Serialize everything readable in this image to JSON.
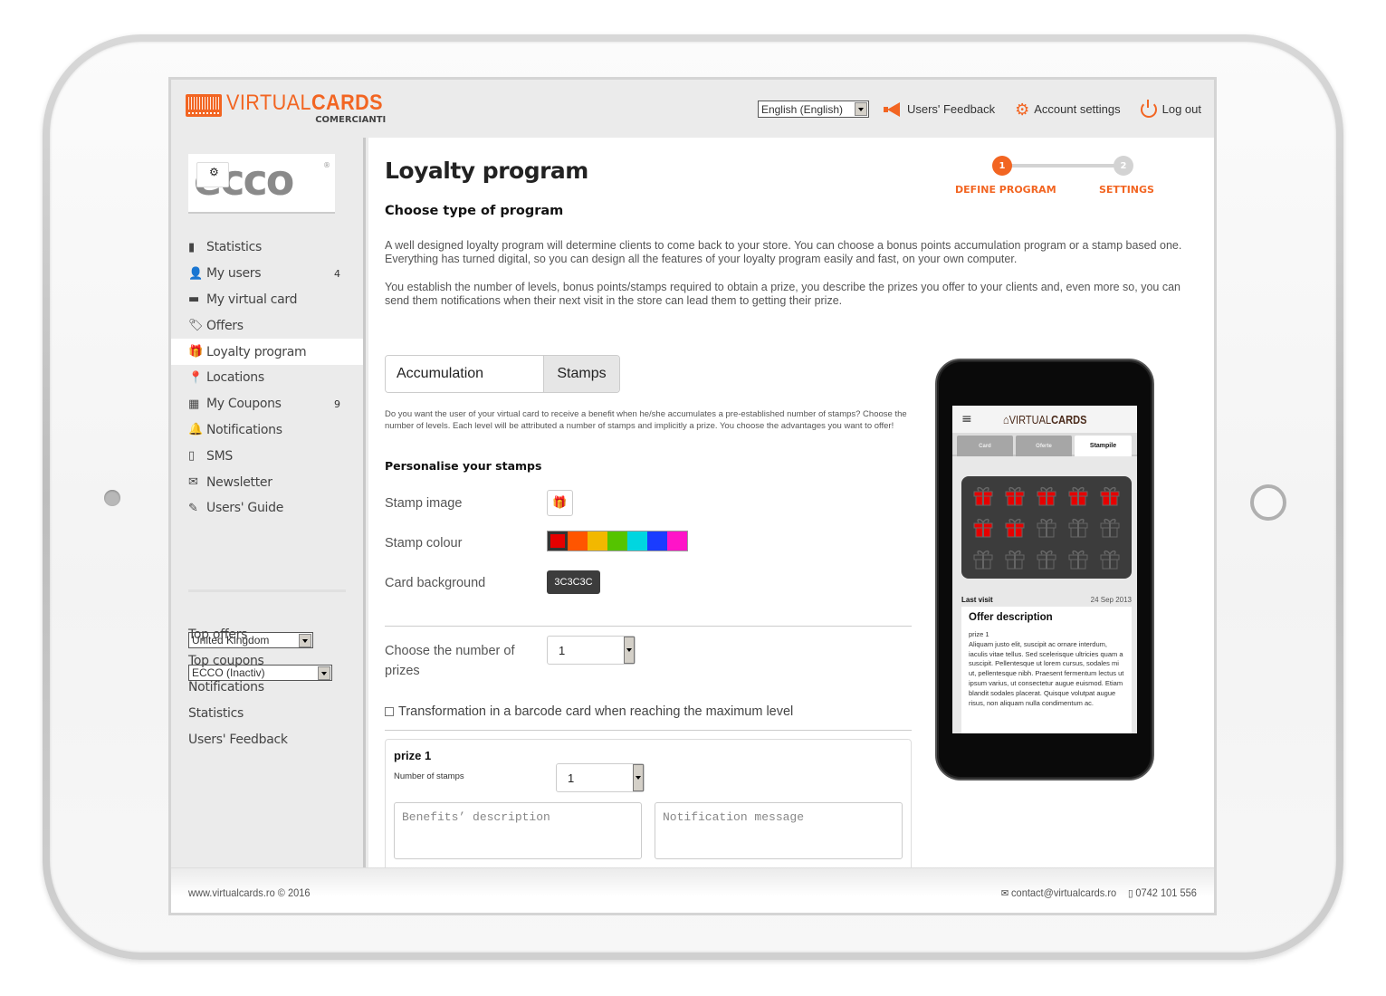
{
  "app": {
    "logo_main_light": "VIRTUAL",
    "logo_main_bold": "CARDS",
    "logo_sub": "COMERCIANTI"
  },
  "header": {
    "language_selected": "English (English)",
    "feedback_label": "Users' Feedback",
    "account_label": "Account settings",
    "logout_label": "Log out"
  },
  "sidebar": {
    "brand_name": "ecco",
    "brand_reg": "®",
    "items": [
      {
        "icon": "bar-chart-icon",
        "glyph": "▮",
        "label": "Statistics",
        "count": ""
      },
      {
        "icon": "user-icon",
        "glyph": "👤",
        "label": "My users",
        "count": "4"
      },
      {
        "icon": "card-icon",
        "glyph": "▬",
        "label": "My virtual card",
        "count": ""
      },
      {
        "icon": "tags-icon",
        "glyph": "🏷",
        "label": "Offers",
        "count": ""
      },
      {
        "icon": "gift-icon",
        "glyph": "🎁",
        "label": "Loyalty program",
        "count": "",
        "active": true
      },
      {
        "icon": "map-marker-icon",
        "glyph": "📍",
        "label": "Locations",
        "count": ""
      },
      {
        "icon": "coupon-icon",
        "glyph": "▦",
        "label": "My Coupons",
        "count": "9"
      },
      {
        "icon": "bell-icon",
        "glyph": "🔔",
        "label": "Notifications",
        "count": ""
      },
      {
        "icon": "phone-icon",
        "glyph": "▯",
        "label": "SMS",
        "count": ""
      },
      {
        "icon": "envelope-icon",
        "glyph": "✉",
        "label": "Newsletter",
        "count": ""
      },
      {
        "icon": "pencil-icon",
        "glyph": "✎",
        "label": "Users' Guide",
        "count": ""
      }
    ],
    "country_selected": "United Kingdom",
    "store_selected": "ECCO (Inactiv)",
    "links": [
      "Top offers",
      "Top coupons",
      "Notifications",
      "Statistics",
      "Users' Feedback"
    ]
  },
  "main": {
    "title": "Loyalty program",
    "subtitle": "Choose type of program",
    "steps": [
      {
        "number": "1",
        "label": "DEFINE PROGRAM",
        "active": true
      },
      {
        "number": "2",
        "label": "SETTINGS",
        "active": false
      }
    ],
    "intro_1": "A well designed loyalty program will determine clients to come back to your store. You can choose a bonus points accumulation program or a stamp based one. Everything has turned digital, so you can design all the features of your loyalty program easily and fast, on your own computer.",
    "intro_2": "You establish the number of levels, bonus points/stamps required to obtain a prize, you describe the prizes you offer to your clients and, even more so, you can send them notifications when their next visit in the store can lead them to getting their prize.",
    "program_types": [
      "Accumulation",
      "Stamps"
    ],
    "program_type_selected": "Stamps",
    "stamps_description": "Do you want the user of your virtual card to receive a benefit when he/she accumulates a pre-established number of stamps? Choose the number of levels. Each level will be attributed a number of stamps and implicitly a prize. You choose the advantages you want to offer!",
    "personalise_heading": "Personalise your stamps",
    "stamp_image_label": "Stamp image",
    "stamp_colour_label": "Stamp colour",
    "stamp_colours": [
      "#e60000",
      "#ff5500",
      "#f2b800",
      "#55c400",
      "#00d6e0",
      "#1a3cff",
      "#ff14c8"
    ],
    "stamp_colour_selected": "#e60000",
    "card_background_label": "Card background",
    "card_background_value": "3C3C3C",
    "prizes_count_label": "Choose the number of prizes",
    "prizes_count_value": "1",
    "barcode_checkbox_label": "Transformation in a barcode card when reaching the maximum level",
    "barcode_checked": false,
    "prize": {
      "title": "prize 1",
      "stamps_label": "Number of stamps",
      "stamps_value": "1",
      "benefits_placeholder": "Benefits’ description",
      "notification_placeholder": "Notification message"
    }
  },
  "preview": {
    "menu_glyph": "≡",
    "logo_light": "VIRTUAL",
    "logo_bold": "CARDS",
    "tabs": [
      "Card",
      "Oferte",
      "Stampile"
    ],
    "active_tab": "Stampile",
    "total_stamps": 15,
    "filled_stamps": 7,
    "stamp_color": "#e60000",
    "last_visit_label": "Last visit",
    "last_visit_date": "24 Sep 2013",
    "offer_title": "Offer description",
    "offer_prize": "prize 1",
    "offer_text": "Aliquam justo elit, suscipit ac ornare interdum, iaculis vitae tellus. Sed scelerisque ultricies quam a suscipit. Pellentesque ut lorem cursus, sodales mi ut, pellentesque nibh. Praesent fermentum lectus ut ipsum varius, ut consectetur augue euismod. Etiam blandit sodales placerat. Quisque volutpat augue risus, non aliquam nulla condimentum ac."
  },
  "footer": {
    "copyright": "www.virtualcards.ro © 2016",
    "email": "contact@virtualcards.ro",
    "phone": "0742 101 556"
  },
  "colors": {
    "accent": "#f26522",
    "card_bg": "#3c3c3c"
  }
}
